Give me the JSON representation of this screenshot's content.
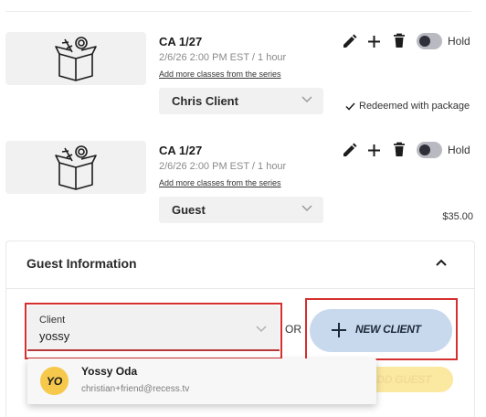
{
  "classes": [
    {
      "title": "CA 1/27",
      "time": "2/6/26 2:00 PM EST / 1 hour",
      "link": "Add more classes from the series",
      "client": "Chris Client",
      "hold_label": "Hold",
      "status": "Redeemed with package"
    },
    {
      "title": "CA 1/27",
      "time": "2/6/26 2:00 PM EST / 1 hour",
      "link": "Add more classes from the series",
      "client": "Guest",
      "hold_label": "Hold",
      "price": "$35.00"
    }
  ],
  "guest_info": {
    "title": "Guest Information",
    "client_label": "Client",
    "client_value": "yossy",
    "or_label": "OR",
    "new_client_label": "NEW CLIENT",
    "add_guest_label": "ADD GUEST",
    "suggestion": {
      "initials": "YO",
      "name": "Yossy Oda",
      "email": "christian+friend@recess.tv"
    }
  },
  "colors": {
    "highlight_outline": "#d62f2f",
    "new_client_bg": "#c8d9ee",
    "add_guest_bg": "#fbe8a1",
    "avatar_bg": "#f6c84b"
  }
}
